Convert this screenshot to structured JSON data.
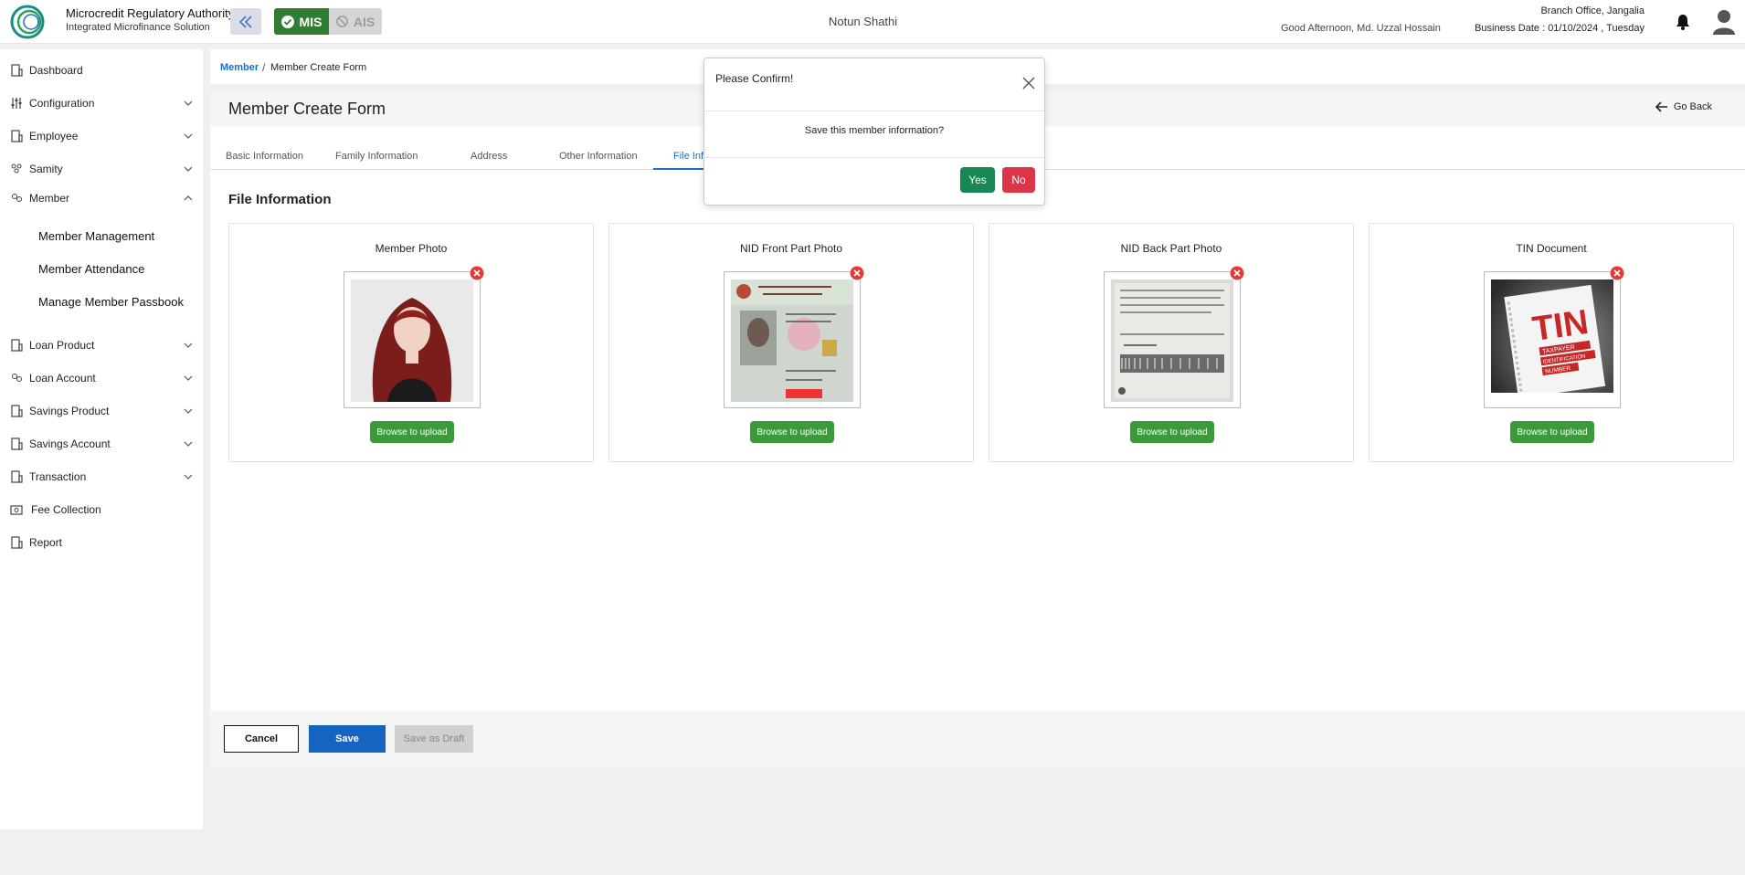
{
  "header": {
    "org_name": "Microcredit Regulatory Authority",
    "org_sub": "Integrated Microfinance Solution",
    "mis_label": "MIS",
    "ais_label": "AIS",
    "app_name": "Notun Shathi",
    "greeting": "Good Afternoon, Md. Uzzal Hossain",
    "branch": "Branch Office, Jangalia",
    "business_date": "Business Date : 01/10/2024 , Tuesday"
  },
  "sidebar": {
    "items": [
      {
        "label": "Dashboard"
      },
      {
        "label": "Configuration"
      },
      {
        "label": "Employee"
      },
      {
        "label": "Samity"
      },
      {
        "label": "Member"
      },
      {
        "label": "Loan Product"
      },
      {
        "label": "Loan Account"
      },
      {
        "label": "Savings Product"
      },
      {
        "label": "Savings Account"
      },
      {
        "label": "Transaction"
      },
      {
        "label": "Fee Collection"
      },
      {
        "label": "Report"
      }
    ],
    "member_sub": [
      "Member Management",
      "Member Attendance",
      "Manage Member Passbook"
    ]
  },
  "breadcrumb": {
    "parent": "Member",
    "separator": "/",
    "current": "Member Create Form"
  },
  "page": {
    "title": "Member Create Form",
    "go_back": "Go Back",
    "section_title": "File Information"
  },
  "tabs": [
    "Basic Information",
    "Family Information",
    "Address",
    "Other Information",
    "File Infor"
  ],
  "cards": [
    {
      "title": "Member Photo",
      "button": "Browse to upload"
    },
    {
      "title": "NID Front Part Photo",
      "button": "Browse to upload"
    },
    {
      "title": "NID Back Part Photo",
      "button": "Browse to upload"
    },
    {
      "title": "TIN Document",
      "button": "Browse to upload"
    }
  ],
  "tin_image": {
    "big": "TIN",
    "line1": "TAXPAYER",
    "line2": "IDENTIFICATION",
    "line3": "NUMBER"
  },
  "footer": {
    "cancel": "Cancel",
    "save": "Save",
    "draft": "Save as Draft"
  },
  "modal": {
    "title": "Please Confirm!",
    "body": "Save this member information?",
    "yes": "Yes",
    "no": "No"
  },
  "colors": {
    "accent": "#1a6fc9",
    "success": "#2e7d32",
    "danger": "#dc3545",
    "save": "#1565c0"
  }
}
